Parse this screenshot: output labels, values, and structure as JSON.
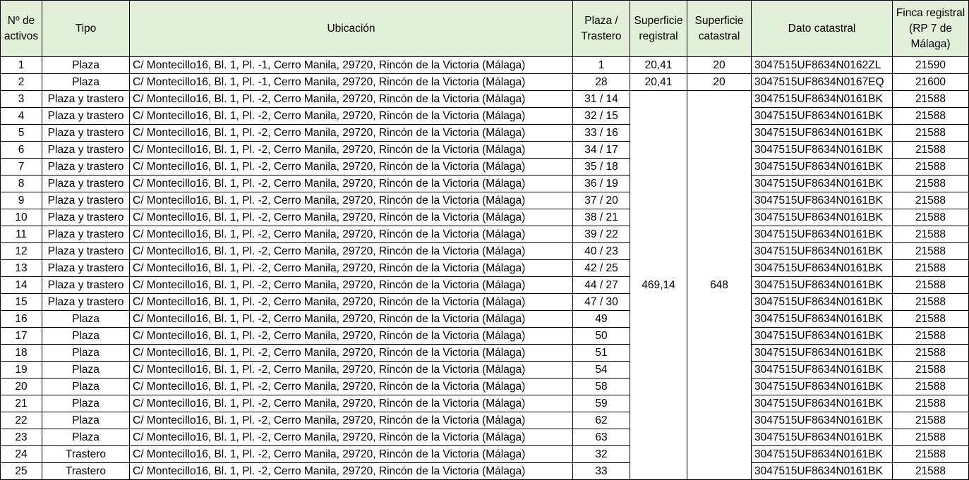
{
  "headers": [
    "Nº de activos",
    "Tipo",
    "Ubicación",
    "Plaza / Trastero",
    "Superficie registral",
    "Superficie catastral",
    "Dato catastral",
    "Finca registral (RP 7 de Málaga)"
  ],
  "merged": {
    "superficie_registral": "469,14",
    "superficie_catastral": "648"
  },
  "rows": [
    {
      "n": "1",
      "tipo": "Plaza",
      "ubicacion": "C/ Montecillo16, Bl. 1, Pl. -1, Cerro Manila, 29720, Rincón de la Victoria (Málaga)",
      "plaza": "1",
      "sup_reg": "20,41",
      "sup_cat": "20",
      "catastral": "3047515UF8634N0162ZL",
      "finca": "21590"
    },
    {
      "n": "2",
      "tipo": "Plaza",
      "ubicacion": "C/ Montecillo16, Bl. 1, Pl. -1, Cerro Manila, 29720, Rincón de la Victoria (Málaga)",
      "plaza": "28",
      "sup_reg": "20,41",
      "sup_cat": "20",
      "catastral": "3047515UF8634N0167EQ",
      "finca": "21600"
    },
    {
      "n": "3",
      "tipo": "Plaza y trastero",
      "ubicacion": "C/ Montecillo16, Bl. 1, Pl. -2, Cerro Manila, 29720, Rincón de la Victoria (Málaga)",
      "plaza": "31 / 14",
      "catastral": "3047515UF8634N0161BK",
      "finca": "21588"
    },
    {
      "n": "4",
      "tipo": "Plaza y trastero",
      "ubicacion": "C/ Montecillo16, Bl. 1, Pl. -2, Cerro Manila, 29720, Rincón de la Victoria (Málaga)",
      "plaza": "32 / 15",
      "catastral": "3047515UF8634N0161BK",
      "finca": "21588"
    },
    {
      "n": "5",
      "tipo": "Plaza y trastero",
      "ubicacion": "C/ Montecillo16, Bl. 1, Pl. -2, Cerro Manila, 29720, Rincón de la Victoria (Málaga)",
      "plaza": "33 / 16",
      "catastral": "3047515UF8634N0161BK",
      "finca": "21588"
    },
    {
      "n": "6",
      "tipo": "Plaza y trastero",
      "ubicacion": "C/ Montecillo16, Bl. 1, Pl. -2, Cerro Manila, 29720, Rincón de la Victoria (Málaga)",
      "plaza": "34 / 17",
      "catastral": "3047515UF8634N0161BK",
      "finca": "21588"
    },
    {
      "n": "7",
      "tipo": "Plaza y trastero",
      "ubicacion": "C/ Montecillo16, Bl. 1, Pl. -2, Cerro Manila, 29720, Rincón de la Victoria (Málaga)",
      "plaza": "35 / 18",
      "catastral": "3047515UF8634N0161BK",
      "finca": "21588"
    },
    {
      "n": "8",
      "tipo": "Plaza y trastero",
      "ubicacion": "C/ Montecillo16, Bl. 1, Pl. -2, Cerro Manila, 29720, Rincón de la Victoria (Málaga)",
      "plaza": "36 / 19",
      "catastral": "3047515UF8634N0161BK",
      "finca": "21588"
    },
    {
      "n": "9",
      "tipo": "Plaza y trastero",
      "ubicacion": "C/ Montecillo16, Bl. 1, Pl. -2, Cerro Manila, 29720, Rincón de la Victoria (Málaga)",
      "plaza": "37 / 20",
      "catastral": "3047515UF8634N0161BK",
      "finca": "21588"
    },
    {
      "n": "10",
      "tipo": "Plaza y trastero",
      "ubicacion": "C/ Montecillo16, Bl. 1, Pl. -2, Cerro Manila, 29720, Rincón de la Victoria (Málaga)",
      "plaza": "38 / 21",
      "catastral": "3047515UF8634N0161BK",
      "finca": "21588"
    },
    {
      "n": "11",
      "tipo": "Plaza y trastero",
      "ubicacion": "C/ Montecillo16, Bl. 1, Pl. -2, Cerro Manila, 29720, Rincón de la Victoria (Málaga)",
      "plaza": "39 / 22",
      "catastral": "3047515UF8634N0161BK",
      "finca": "21588"
    },
    {
      "n": "12",
      "tipo": "Plaza y trastero",
      "ubicacion": "C/ Montecillo16, Bl. 1, Pl. -2, Cerro Manila, 29720, Rincón de la Victoria (Málaga)",
      "plaza": "40 / 23",
      "catastral": "3047515UF8634N0161BK",
      "finca": "21588"
    },
    {
      "n": "13",
      "tipo": "Plaza y trastero",
      "ubicacion": "C/ Montecillo16, Bl. 1, Pl. -2, Cerro Manila, 29720, Rincón de la Victoria (Málaga)",
      "plaza": "42 / 25",
      "catastral": "3047515UF8634N0161BK",
      "finca": "21588"
    },
    {
      "n": "14",
      "tipo": "Plaza y trastero",
      "ubicacion": "C/ Montecillo16, Bl. 1, Pl. -2, Cerro Manila, 29720, Rincón de la Victoria (Málaga)",
      "plaza": "44 / 27",
      "catastral": "3047515UF8634N0161BK",
      "finca": "21588"
    },
    {
      "n": "15",
      "tipo": "Plaza y trastero",
      "ubicacion": "C/ Montecillo16, Bl. 1, Pl. -2, Cerro Manila, 29720, Rincón de la Victoria (Málaga)",
      "plaza": "47 / 30",
      "catastral": "3047515UF8634N0161BK",
      "finca": "21588"
    },
    {
      "n": "16",
      "tipo": "Plaza",
      "ubicacion": "C/ Montecillo16, Bl. 1, Pl. -2, Cerro Manila, 29720, Rincón de la Victoria (Málaga)",
      "plaza": "49",
      "catastral": "3047515UF8634N0161BK",
      "finca": "21588"
    },
    {
      "n": "17",
      "tipo": "Plaza",
      "ubicacion": "C/ Montecillo16, Bl. 1, Pl. -2, Cerro Manila, 29720, Rincón de la Victoria (Málaga)",
      "plaza": "50",
      "catastral": "3047515UF8634N0161BK",
      "finca": "21588"
    },
    {
      "n": "18",
      "tipo": "Plaza",
      "ubicacion": "C/ Montecillo16, Bl. 1, Pl. -2, Cerro Manila, 29720, Rincón de la Victoria (Málaga)",
      "plaza": "51",
      "catastral": "3047515UF8634N0161BK",
      "finca": "21588"
    },
    {
      "n": "19",
      "tipo": "Plaza",
      "ubicacion": "C/ Montecillo16, Bl. 1, Pl. -2, Cerro Manila, 29720, Rincón de la Victoria (Málaga)",
      "plaza": "54",
      "catastral": "3047515UF8634N0161BK",
      "finca": "21588"
    },
    {
      "n": "20",
      "tipo": "Plaza",
      "ubicacion": "C/ Montecillo16, Bl. 1, Pl. -2, Cerro Manila, 29720, Rincón de la Victoria (Málaga)",
      "plaza": "58",
      "catastral": "3047515UF8634N0161BK",
      "finca": "21588"
    },
    {
      "n": "21",
      "tipo": "Plaza",
      "ubicacion": "C/ Montecillo16, Bl. 1, Pl. -2, Cerro Manila, 29720, Rincón de la Victoria (Málaga)",
      "plaza": "59",
      "catastral": "3047515UF8634N0161BK",
      "finca": "21588"
    },
    {
      "n": "22",
      "tipo": "Plaza",
      "ubicacion": "C/ Montecillo16, Bl. 1, Pl. -2, Cerro Manila, 29720, Rincón de la Victoria (Málaga)",
      "plaza": "62",
      "catastral": "3047515UF8634N0161BK",
      "finca": "21588"
    },
    {
      "n": "23",
      "tipo": "Plaza",
      "ubicacion": "C/ Montecillo16, Bl. 1, Pl. -2, Cerro Manila, 29720, Rincón de la Victoria (Málaga)",
      "plaza": "63",
      "catastral": "3047515UF8634N0161BK",
      "finca": "21588"
    },
    {
      "n": "24",
      "tipo": "Trastero",
      "ubicacion": "C/ Montecillo16, Bl. 1, Pl. -2, Cerro Manila, 29720, Rincón de la Victoria (Málaga)",
      "plaza": "32",
      "catastral": "3047515UF8634N0161BK",
      "finca": "21588"
    },
    {
      "n": "25",
      "tipo": "Trastero",
      "ubicacion": "C/ Montecillo16, Bl. 1, Pl. -2, Cerro Manila, 29720, Rincón de la Victoria (Málaga)",
      "plaza": "33",
      "catastral": "3047515UF8634N0161BK",
      "finca": "21588"
    }
  ],
  "colors": {
    "header_background": "#e2efd9",
    "border": "#000000"
  }
}
